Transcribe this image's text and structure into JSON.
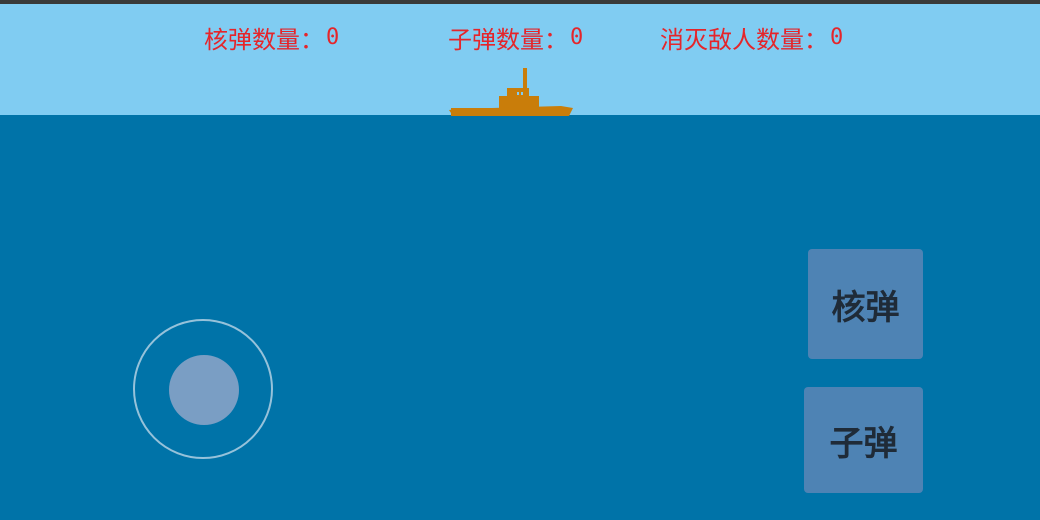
{
  "hud": {
    "nukes": {
      "label": "核弹数量：",
      "value": "0"
    },
    "bullets": {
      "label": "子弹数量：",
      "value": "0"
    },
    "kills": {
      "label": "消灭敌人数量：",
      "value": "0"
    }
  },
  "controls": {
    "nuke_button_label": "核弹",
    "bullet_button_label": "子弹"
  },
  "colors": {
    "sky": "#80ccf2",
    "sea": "#0073a8",
    "hud_text": "#e5252a",
    "ship": "#c97d0a",
    "button_bg": "#4e83b4"
  },
  "icons": {
    "ship": "ship-icon",
    "joystick": "joystick-icon"
  }
}
